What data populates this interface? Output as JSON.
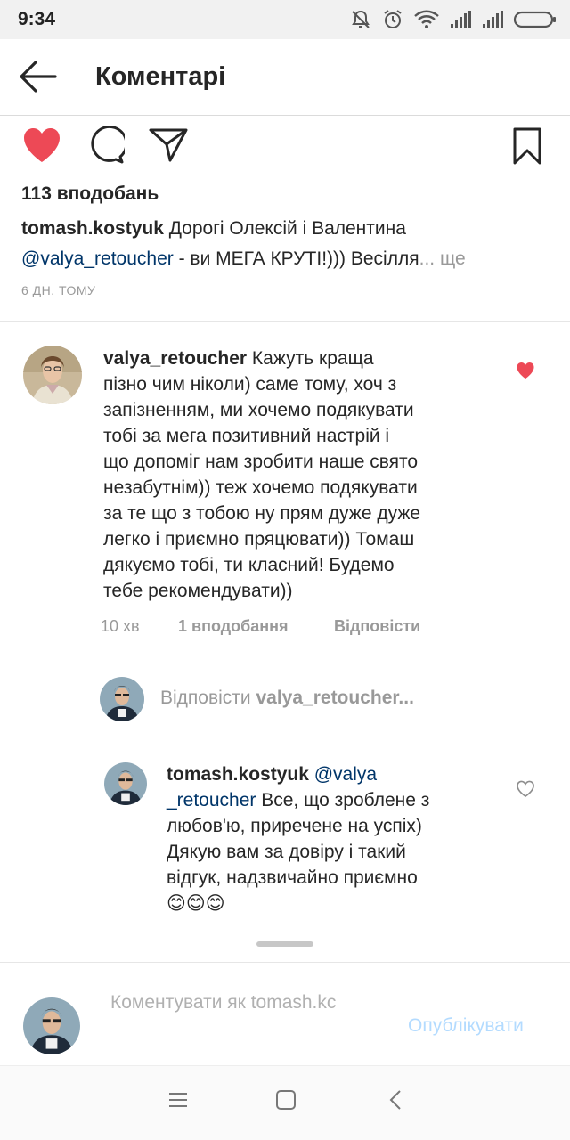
{
  "status_bar": {
    "time": "9:34",
    "icons": [
      "mute-icon",
      "alarm-icon",
      "wifi-icon",
      "signal-icon",
      "signal-icon",
      "battery-icon"
    ]
  },
  "header": {
    "title": "Коментарі",
    "back_icon": "arrow-left-icon"
  },
  "post": {
    "actions": [
      "heart-filled-icon",
      "comment-icon",
      "share-icon",
      "bookmark-icon"
    ],
    "likes": "113 вподобань",
    "caption_user": "tomash.kostyuk",
    "caption_text_1": " Дорогі Олексій і Валентина",
    "caption_mention": "@valya_retoucher",
    "caption_text_2": " - ви МЕГА КРУТІ!))) Весілля",
    "caption_more": "... ще",
    "time": "6 ДН. ТОМУ"
  },
  "comment": {
    "user": "valya_retoucher",
    "lines": [
      " Кажуть краща",
      "пізно чим ніколи) саме тому, хоч з",
      "запізненням, ми хочемо подякувати",
      "тобі за мега позитивний настрій і",
      "що допоміг нам зробити наше свято",
      "незабутнім)) теж хочемо подякувати",
      "за те що з тобою ну прям дуже дуже",
      "легко і приємно пряцювати)) Томаш",
      "дякуємо тобі, ти  класний! Будемо",
      "тебе рекомендувати))"
    ],
    "time": "10 хв",
    "likes": "1 вподобання",
    "reply": "Відповісти"
  },
  "reply_hint": {
    "prefix": "Відповісти ",
    "user": "valya_retoucher..."
  },
  "reply": {
    "user": "tomash.kostyuk",
    "mention_1": " @valya",
    "mention_2": "_retoucher",
    "line_1_rest": " Все, що зроблене з",
    "lines": [
      "любов'ю, приречене на успіх)",
      "Дякую вам за довіру і такий",
      "відгук, надзвичайно приємно"
    ],
    "emoji": "😊😊😊"
  },
  "composer": {
    "placeholder": "Коментувати як tomash.kc",
    "publish": "Опублікувати"
  },
  "nav": {
    "icons": [
      "menu-icon",
      "home-square-icon",
      "back-chevron-icon"
    ]
  },
  "colors": {
    "like_red": "#ed4956",
    "mention_blue": "#003569",
    "publish_disabled": "#b3dbff",
    "muted_gray": "#999999"
  }
}
